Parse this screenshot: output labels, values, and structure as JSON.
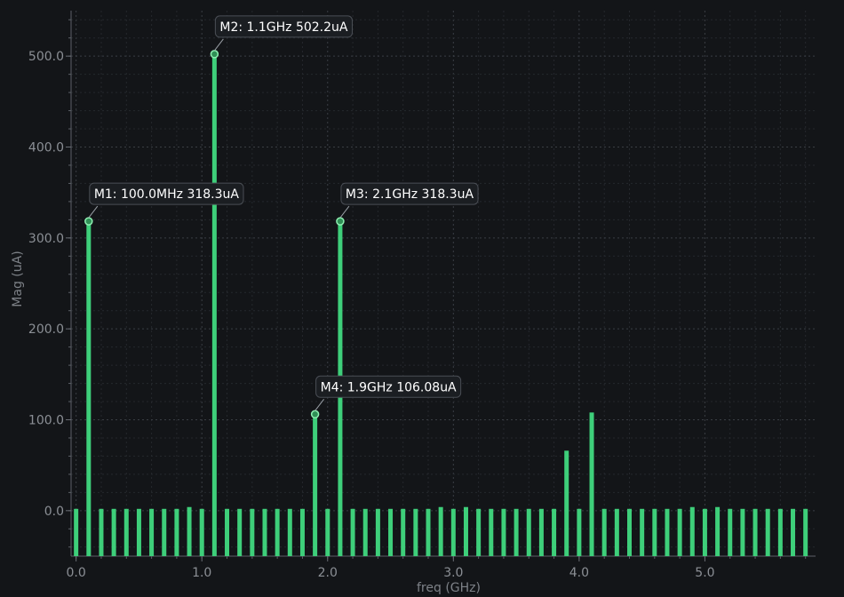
{
  "chart_data": {
    "type": "bar",
    "title": "",
    "xlabel": "freq (GHz)",
    "ylabel": "Mag (uA)",
    "xlim": [
      -0.04,
      5.88
    ],
    "ylim": [
      -50,
      550
    ],
    "baseline": -50,
    "x_ticks": [
      0.0,
      1.0,
      2.0,
      3.0,
      4.0,
      5.0
    ],
    "x_tick_labels": [
      "0.0",
      "1.0",
      "2.0",
      "3.0",
      "4.0",
      "5.0"
    ],
    "y_ticks": [
      0.0,
      100.0,
      200.0,
      300.0,
      400.0,
      500.0
    ],
    "y_tick_labels": [
      "0.0",
      "100.0",
      "200.0",
      "300.0",
      "400.0",
      "500.0"
    ],
    "grid": true,
    "bar_color": "#3ecf7a",
    "background": "#131518",
    "series": [
      {
        "x": [
          0.0,
          0.1,
          0.2,
          0.3,
          0.4,
          0.5,
          0.6,
          0.7,
          0.8,
          0.9,
          1.0,
          1.1,
          1.2,
          1.3,
          1.4,
          1.5,
          1.6,
          1.7,
          1.8,
          1.9,
          2.0,
          2.1,
          2.2,
          2.3,
          2.4,
          2.5,
          2.6,
          2.7,
          2.8,
          2.9,
          3.0,
          3.1,
          3.2,
          3.3,
          3.4,
          3.5,
          3.6,
          3.7,
          3.8,
          3.9,
          4.0,
          4.1,
          4.2,
          4.3,
          4.4,
          4.5,
          4.6,
          4.7,
          4.8,
          4.9,
          5.0,
          5.1,
          5.2,
          5.3,
          5.4,
          5.5,
          5.6,
          5.7,
          5.8
        ],
        "values": [
          2,
          318.3,
          2,
          2,
          2,
          2,
          2,
          2,
          2,
          4,
          2,
          502.2,
          2,
          2,
          2,
          2,
          2,
          2,
          2,
          106.08,
          2,
          318.3,
          2,
          2,
          2,
          2,
          2,
          2,
          2,
          4,
          2,
          4,
          2,
          2,
          2,
          2,
          2,
          2,
          2,
          66,
          2,
          108,
          2,
          2,
          2,
          2,
          2,
          2,
          2,
          4,
          2,
          4,
          2,
          2,
          2,
          2,
          2,
          2,
          2
        ]
      }
    ],
    "markers": [
      {
        "label": "M1: 100.0MHz 318.3uA",
        "x": 0.1,
        "y": 318.3
      },
      {
        "label": "M2: 1.1GHz 502.2uA",
        "x": 1.1,
        "y": 502.2
      },
      {
        "label": "M3: 2.1GHz 318.3uA",
        "x": 2.1,
        "y": 318.3
      },
      {
        "label": "M4: 1.9GHz 106.08uA",
        "x": 1.9,
        "y": 106.08
      }
    ]
  }
}
